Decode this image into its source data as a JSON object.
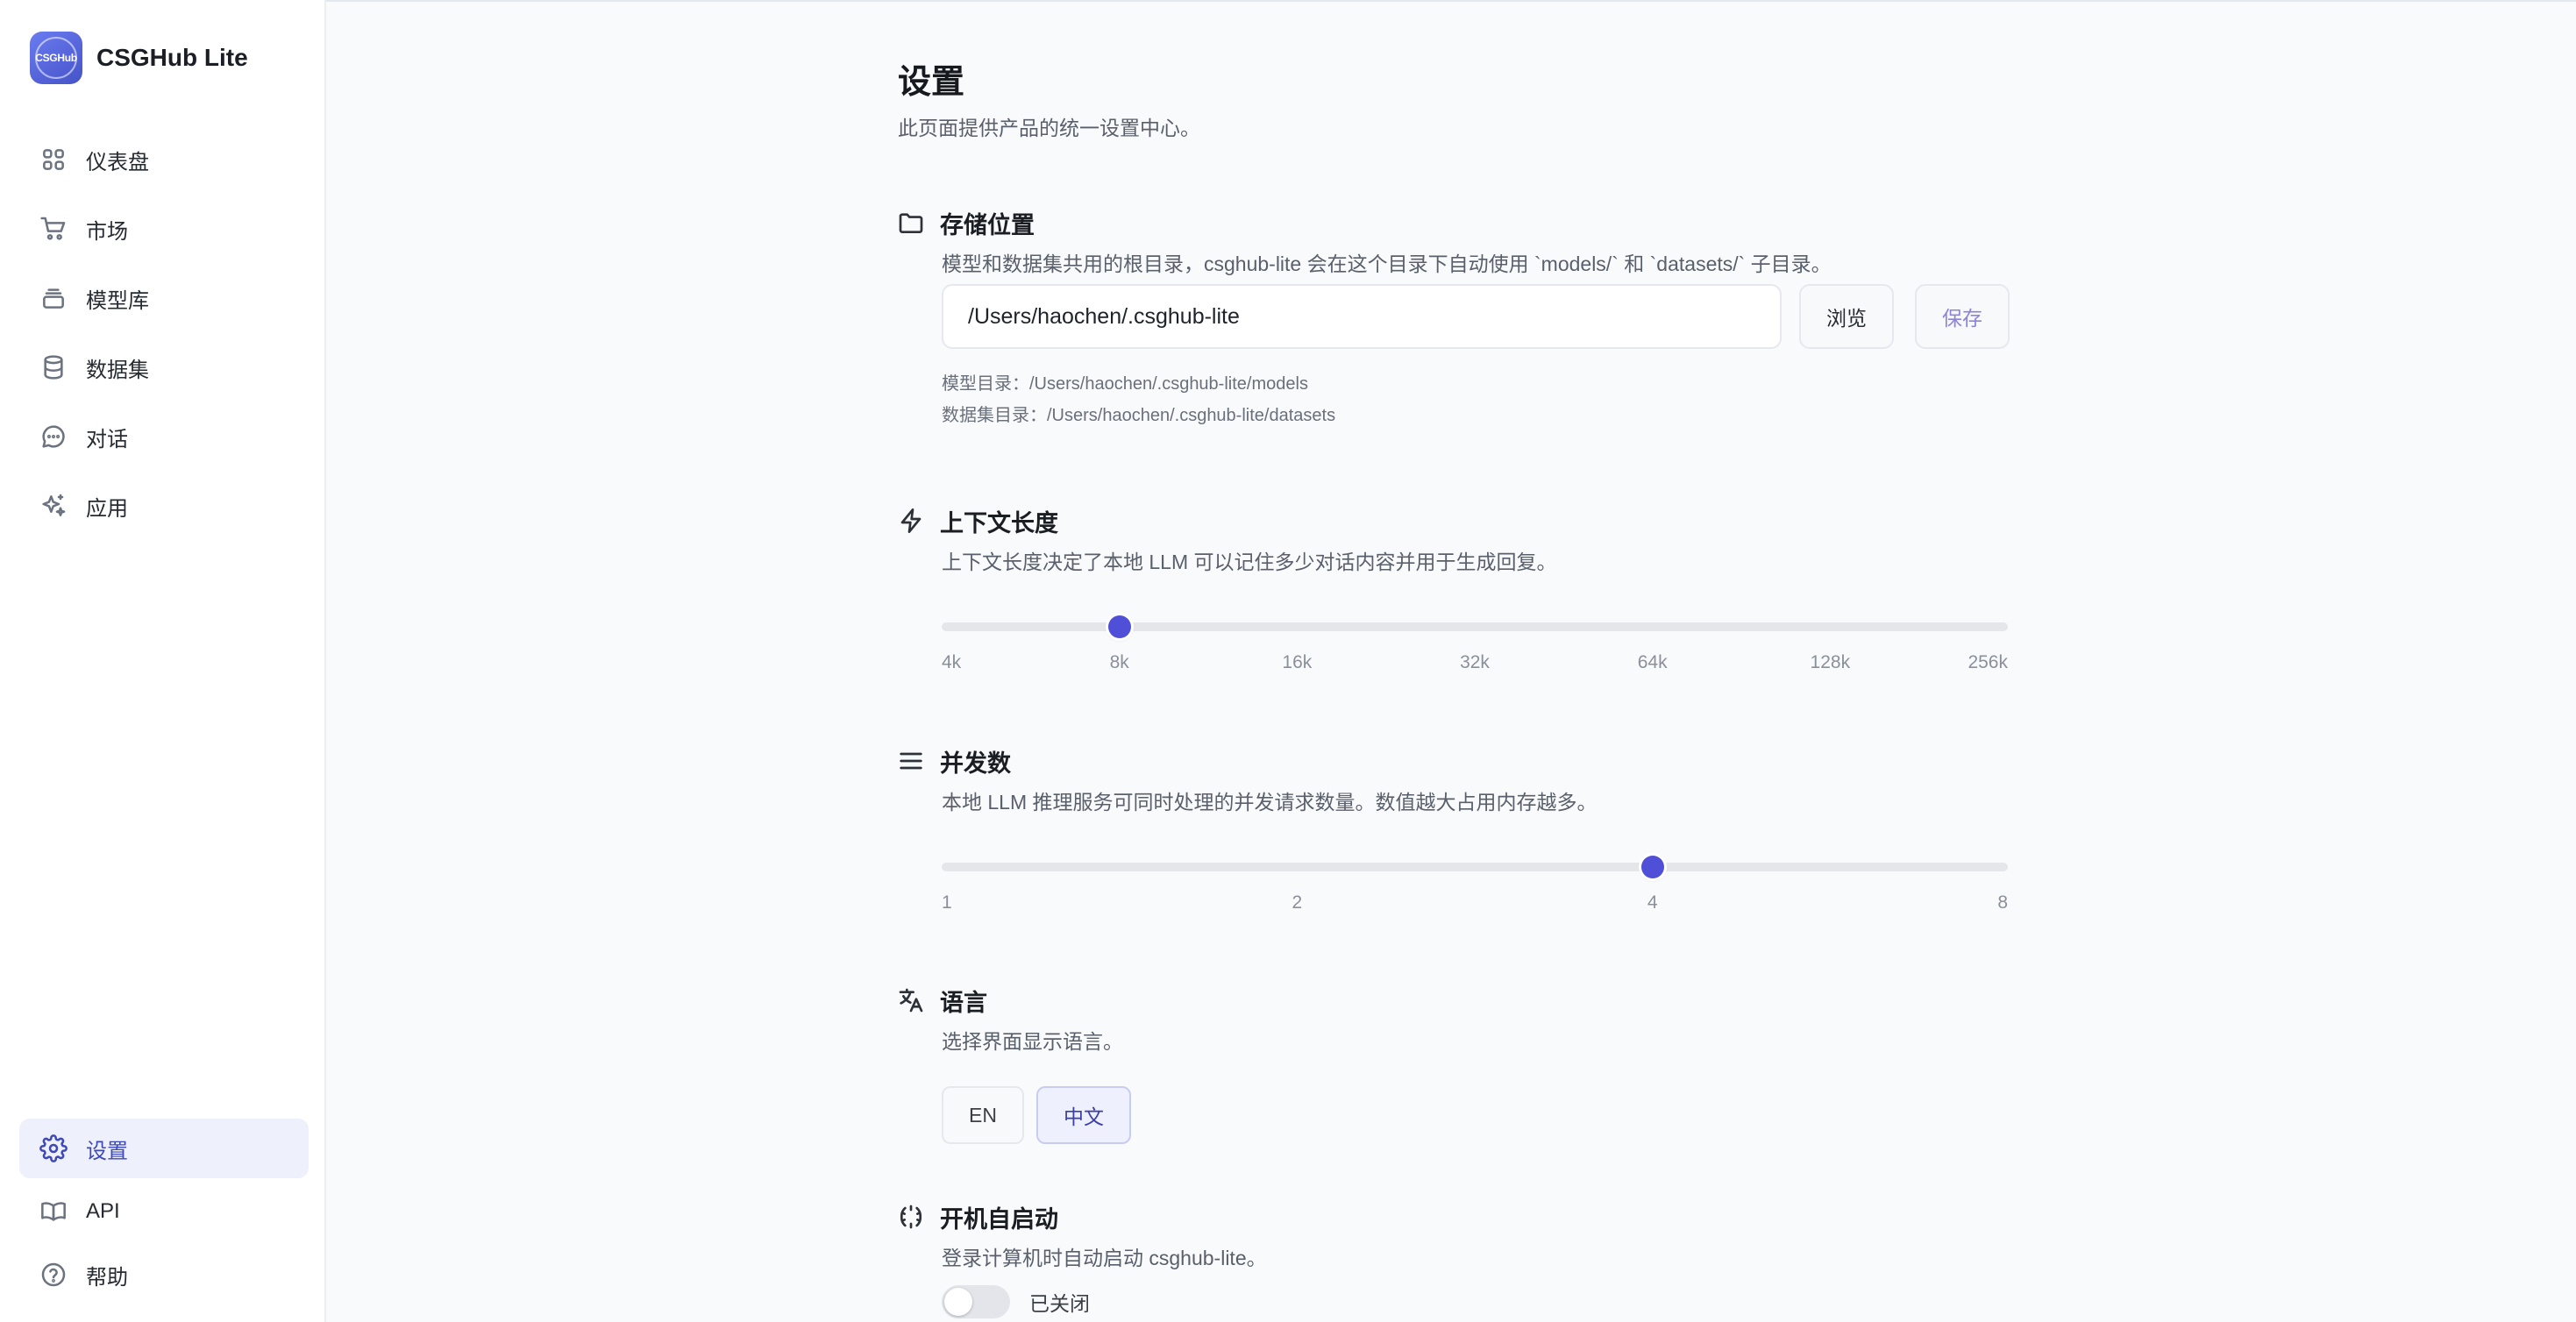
{
  "app": {
    "name": "CSGHub Lite",
    "logo_text": "CSGHub"
  },
  "sidebar": {
    "items": [
      {
        "label": "仪表盘",
        "icon": "dashboard-icon"
      },
      {
        "label": "市场",
        "icon": "cart-icon"
      },
      {
        "label": "模型库",
        "icon": "layers-icon"
      },
      {
        "label": "数据集",
        "icon": "database-icon"
      },
      {
        "label": "对话",
        "icon": "chat-icon"
      },
      {
        "label": "应用",
        "icon": "sparkles-icon"
      }
    ],
    "bottom_items": [
      {
        "label": "设置",
        "icon": "gear-icon",
        "active": true
      },
      {
        "label": "API",
        "icon": "book-icon"
      },
      {
        "label": "帮助",
        "icon": "help-icon"
      }
    ]
  },
  "page": {
    "title": "设置",
    "description": "此页面提供产品的统一设置中心。"
  },
  "storage": {
    "title": "存储位置",
    "icon": "folder-icon",
    "description": "模型和数据集共用的根目录，csghub-lite 会在这个目录下自动使用 `models/` 和 `datasets/` 子目录。",
    "path_value": "/Users/haochen/.csghub-lite",
    "browse_label": "浏览",
    "save_label": "保存",
    "models_dir": "模型目录：/Users/haochen/.csghub-lite/models",
    "datasets_dir": "数据集目录：/Users/haochen/.csghub-lite/datasets"
  },
  "context": {
    "title": "上下文长度",
    "icon": "bolt-icon",
    "description": "上下文长度决定了本地 LLM 可以记住多少对话内容并用于生成回复。",
    "ticks": [
      "4k",
      "8k",
      "16k",
      "32k",
      "64k",
      "128k",
      "256k"
    ],
    "selected": "8k"
  },
  "concurrency": {
    "title": "并发数",
    "icon": "menu-icon",
    "description": "本地 LLM 推理服务可同时处理的并发请求数量。数值越大占用内存越多。",
    "ticks": [
      "1",
      "2",
      "4",
      "8"
    ],
    "selected": "4"
  },
  "language": {
    "title": "语言",
    "icon": "translate-icon",
    "description": "选择界面显示语言。",
    "options": [
      "EN",
      "中文"
    ],
    "selected": "中文"
  },
  "autostart": {
    "title": "开机自启动",
    "icon": "loader-icon",
    "description": "登录计算机时自动启动 csghub-lite。",
    "enabled": false,
    "status_label": "已关闭"
  },
  "colors": {
    "accent": "#4f4fd8",
    "active_nav_bg": "#eef0fb",
    "active_nav_text": "#3e49b8"
  }
}
